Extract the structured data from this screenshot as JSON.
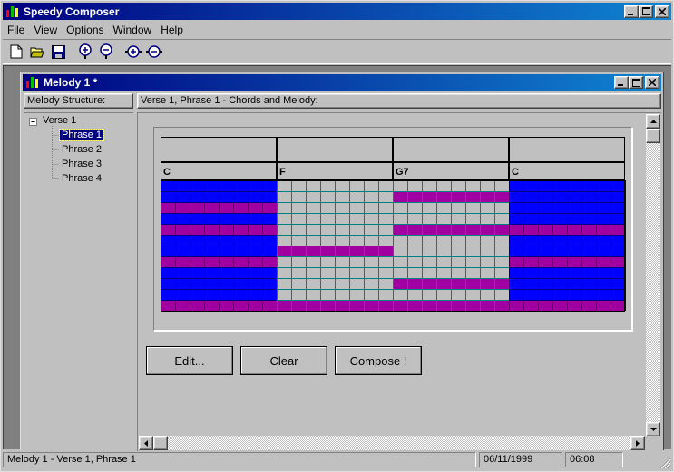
{
  "app": {
    "title": "Speedy Composer"
  },
  "menu": [
    "File",
    "View",
    "Options",
    "Window",
    "Help"
  ],
  "toolbar": [
    "new-file-icon",
    "open-folder-icon",
    "save-icon",
    "zoom-in-icon",
    "zoom-out-icon",
    "zoom-in-alt-icon",
    "zoom-out-alt-icon"
  ],
  "child": {
    "title": "Melody 1 *",
    "left_header": "Melody Structure:",
    "right_header": "Verse 1, Phrase 1 - Chords and Melody:"
  },
  "tree": {
    "root": "Verse 1",
    "items": [
      "Phrase 1",
      "Phrase 2",
      "Phrase 3",
      "Phrase 4"
    ],
    "selected": 0
  },
  "grid": {
    "chords": [
      "C",
      "F",
      "G7",
      "C"
    ],
    "rows": 12,
    "cols_per_measure": 8,
    "measure_styles": [
      "blue",
      "gray",
      "gray",
      "blue"
    ],
    "melody_rows": {
      "0": [],
      "1": [
        2
      ],
      "2": [
        0
      ],
      "3": [],
      "4": [
        0,
        2,
        3
      ],
      "6": [
        1
      ],
      "7": [
        0,
        3
      ],
      "9": [
        2
      ],
      "11": [
        0,
        1,
        2,
        3
      ]
    },
    "colors": {
      "blue": "#0000ff",
      "gray": "#c0c0c0",
      "melody": "#a000a0",
      "line_blue": "#000080",
      "line_gray": "#008080"
    }
  },
  "buttons": {
    "edit": "Edit...",
    "clear": "Clear",
    "compose": "Compose !"
  },
  "status": {
    "text": "Melody 1 - Verse 1, Phrase 1",
    "date": "06/11/1999",
    "time": "06:08"
  }
}
